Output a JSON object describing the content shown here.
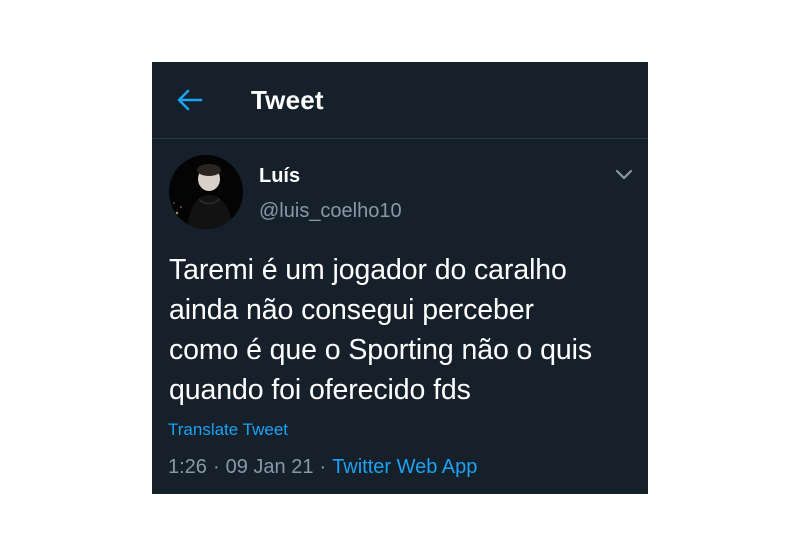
{
  "header": {
    "title": "Tweet",
    "back_icon": "arrow-left-icon"
  },
  "tweet": {
    "author": {
      "display_name": "Luís",
      "handle": "@luis_coelho10",
      "avatar_icon": "avatar"
    },
    "text": "Taremi é um jogador do caralho\nainda não consegui perceber\ncomo é que o Sporting não o quis\nquando foi oferecido fds",
    "translate_label": "Translate Tweet",
    "time": "1:26",
    "separator": "·",
    "date": "09 Jan 21",
    "source": "Twitter Web App"
  },
  "colors": {
    "background": "#15202b",
    "accent": "#1da1f2",
    "secondary_text": "#8899a6",
    "divider": "#2a3744"
  }
}
